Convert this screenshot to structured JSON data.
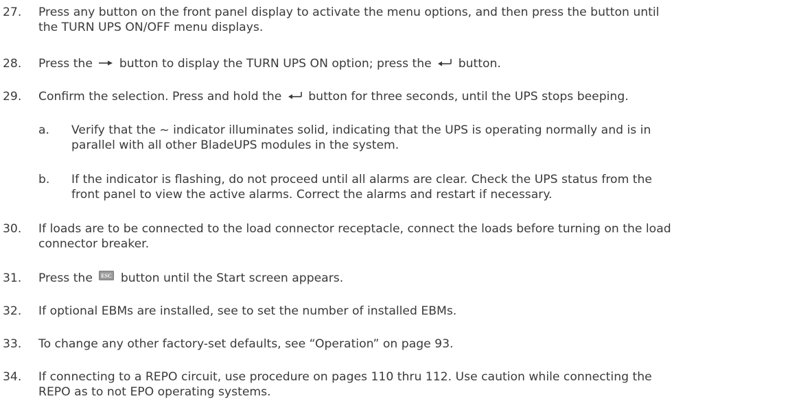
{
  "steps": {
    "s27": {
      "number": "27.",
      "line1": "Press any button on the front panel display to activate the menu options, and then press the  button until",
      "line2": "the TURN UPS ON/OFF menu displays."
    },
    "s28": {
      "number": "28.",
      "text_before": "Press the",
      "text_middle": "button to display the TURN UPS ON option; press the",
      "text_after": "button."
    },
    "s29": {
      "number": "29.",
      "text_before": "Confirm the selection. Press and hold the",
      "text_after": "button for three seconds, until the UPS stops beeping."
    },
    "s29a": {
      "number": "a.",
      "line1": "Verify that the ~ indicator illuminates solid, indicating that the UPS is operating normally and is in",
      "line2": "parallel with all other BladeUPS modules in the system."
    },
    "s29b": {
      "number": "b.",
      "line1": "If the indicator is flashing, do not proceed until all alarms are clear. Check the UPS status from the",
      "line2": "front panel to view the active alarms. Correct the alarms and restart if necessary."
    },
    "s30": {
      "number": "30.",
      "line1": "If loads are to be connected to the load connector receptacle, connect the loads before turning on the load",
      "line2": "connector breaker."
    },
    "s31": {
      "number": "31.",
      "text_before": "Press the",
      "key_label": "ESC",
      "text_after": "button until the Start screen appears."
    },
    "s32": {
      "number": "32.",
      "line1": "If optional EBMs are installed, see to set the number of installed EBMs."
    },
    "s33": {
      "number": "33.",
      "line1": "To change any other factory-set defaults, see “Operation” on page 93."
    },
    "s34": {
      "number": "34.",
      "line1": "If connecting to a REPO circuit, use procedure on pages 110 thru 112. Use caution while connecting the",
      "line2": "REPO as to not EPO operating systems."
    }
  },
  "icons": {
    "right_arrow": "right-arrow-icon",
    "enter": "enter-arrow-icon",
    "esc_key": "esc-key-icon"
  },
  "colors": {
    "text": "#3a3a3a",
    "esc_key_fill": "#9a9a9a",
    "esc_key_text": "#ffffff"
  }
}
